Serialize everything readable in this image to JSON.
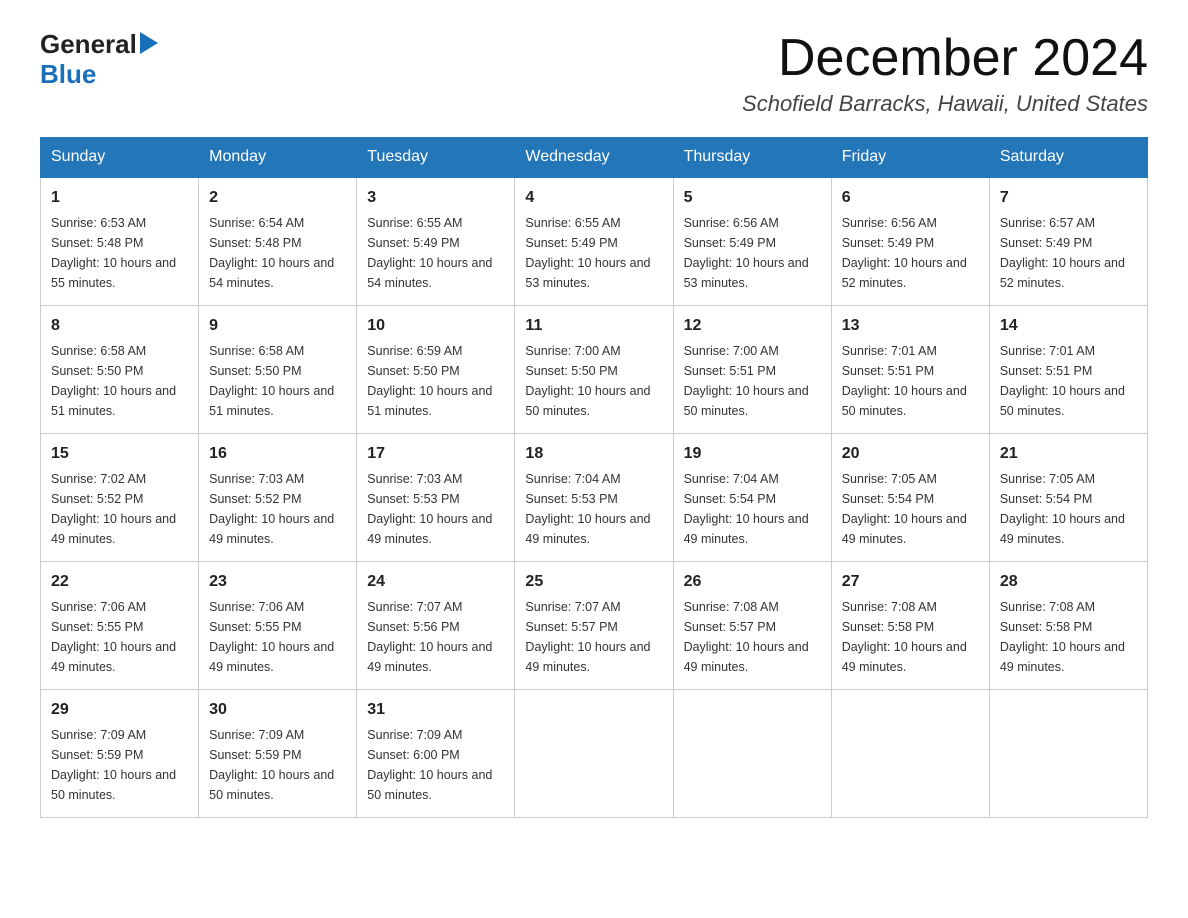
{
  "logo": {
    "general": "General",
    "blue": "Blue"
  },
  "title": "December 2024",
  "location": "Schofield Barracks, Hawaii, United States",
  "days_of_week": [
    "Sunday",
    "Monday",
    "Tuesday",
    "Wednesday",
    "Thursday",
    "Friday",
    "Saturday"
  ],
  "weeks": [
    [
      {
        "day": "1",
        "sunrise": "6:53 AM",
        "sunset": "5:48 PM",
        "daylight": "10 hours and 55 minutes."
      },
      {
        "day": "2",
        "sunrise": "6:54 AM",
        "sunset": "5:48 PM",
        "daylight": "10 hours and 54 minutes."
      },
      {
        "day": "3",
        "sunrise": "6:55 AM",
        "sunset": "5:49 PM",
        "daylight": "10 hours and 54 minutes."
      },
      {
        "day": "4",
        "sunrise": "6:55 AM",
        "sunset": "5:49 PM",
        "daylight": "10 hours and 53 minutes."
      },
      {
        "day": "5",
        "sunrise": "6:56 AM",
        "sunset": "5:49 PM",
        "daylight": "10 hours and 53 minutes."
      },
      {
        "day": "6",
        "sunrise": "6:56 AM",
        "sunset": "5:49 PM",
        "daylight": "10 hours and 52 minutes."
      },
      {
        "day": "7",
        "sunrise": "6:57 AM",
        "sunset": "5:49 PM",
        "daylight": "10 hours and 52 minutes."
      }
    ],
    [
      {
        "day": "8",
        "sunrise": "6:58 AM",
        "sunset": "5:50 PM",
        "daylight": "10 hours and 51 minutes."
      },
      {
        "day": "9",
        "sunrise": "6:58 AM",
        "sunset": "5:50 PM",
        "daylight": "10 hours and 51 minutes."
      },
      {
        "day": "10",
        "sunrise": "6:59 AM",
        "sunset": "5:50 PM",
        "daylight": "10 hours and 51 minutes."
      },
      {
        "day": "11",
        "sunrise": "7:00 AM",
        "sunset": "5:50 PM",
        "daylight": "10 hours and 50 minutes."
      },
      {
        "day": "12",
        "sunrise": "7:00 AM",
        "sunset": "5:51 PM",
        "daylight": "10 hours and 50 minutes."
      },
      {
        "day": "13",
        "sunrise": "7:01 AM",
        "sunset": "5:51 PM",
        "daylight": "10 hours and 50 minutes."
      },
      {
        "day": "14",
        "sunrise": "7:01 AM",
        "sunset": "5:51 PM",
        "daylight": "10 hours and 50 minutes."
      }
    ],
    [
      {
        "day": "15",
        "sunrise": "7:02 AM",
        "sunset": "5:52 PM",
        "daylight": "10 hours and 49 minutes."
      },
      {
        "day": "16",
        "sunrise": "7:03 AM",
        "sunset": "5:52 PM",
        "daylight": "10 hours and 49 minutes."
      },
      {
        "day": "17",
        "sunrise": "7:03 AM",
        "sunset": "5:53 PM",
        "daylight": "10 hours and 49 minutes."
      },
      {
        "day": "18",
        "sunrise": "7:04 AM",
        "sunset": "5:53 PM",
        "daylight": "10 hours and 49 minutes."
      },
      {
        "day": "19",
        "sunrise": "7:04 AM",
        "sunset": "5:54 PM",
        "daylight": "10 hours and 49 minutes."
      },
      {
        "day": "20",
        "sunrise": "7:05 AM",
        "sunset": "5:54 PM",
        "daylight": "10 hours and 49 minutes."
      },
      {
        "day": "21",
        "sunrise": "7:05 AM",
        "sunset": "5:54 PM",
        "daylight": "10 hours and 49 minutes."
      }
    ],
    [
      {
        "day": "22",
        "sunrise": "7:06 AM",
        "sunset": "5:55 PM",
        "daylight": "10 hours and 49 minutes."
      },
      {
        "day": "23",
        "sunrise": "7:06 AM",
        "sunset": "5:55 PM",
        "daylight": "10 hours and 49 minutes."
      },
      {
        "day": "24",
        "sunrise": "7:07 AM",
        "sunset": "5:56 PM",
        "daylight": "10 hours and 49 minutes."
      },
      {
        "day": "25",
        "sunrise": "7:07 AM",
        "sunset": "5:57 PM",
        "daylight": "10 hours and 49 minutes."
      },
      {
        "day": "26",
        "sunrise": "7:08 AM",
        "sunset": "5:57 PM",
        "daylight": "10 hours and 49 minutes."
      },
      {
        "day": "27",
        "sunrise": "7:08 AM",
        "sunset": "5:58 PM",
        "daylight": "10 hours and 49 minutes."
      },
      {
        "day": "28",
        "sunrise": "7:08 AM",
        "sunset": "5:58 PM",
        "daylight": "10 hours and 49 minutes."
      }
    ],
    [
      {
        "day": "29",
        "sunrise": "7:09 AM",
        "sunset": "5:59 PM",
        "daylight": "10 hours and 50 minutes."
      },
      {
        "day": "30",
        "sunrise": "7:09 AM",
        "sunset": "5:59 PM",
        "daylight": "10 hours and 50 minutes."
      },
      {
        "day": "31",
        "sunrise": "7:09 AM",
        "sunset": "6:00 PM",
        "daylight": "10 hours and 50 minutes."
      },
      null,
      null,
      null,
      null
    ]
  ]
}
